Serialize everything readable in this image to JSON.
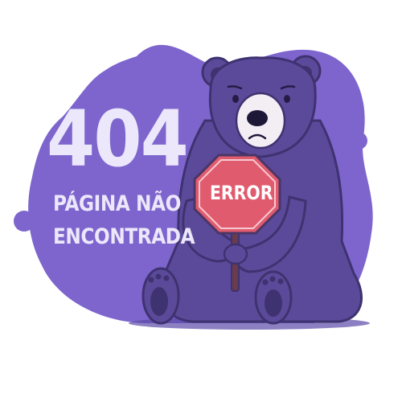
{
  "error": {
    "code": "404",
    "message_line1": "PÁGINA NÃO",
    "message_line2": "ENCONTRADA",
    "sign_text": "ERROR"
  },
  "colors": {
    "background": "#ffffff",
    "blob": "#7d65cd",
    "text": "#ece7fb",
    "bear_fur": "#5b4a9a",
    "bear_shade": "#3f3270",
    "sign": "#e15b6f"
  },
  "illustration": {
    "character": "bear",
    "prop": "stop-sign"
  }
}
